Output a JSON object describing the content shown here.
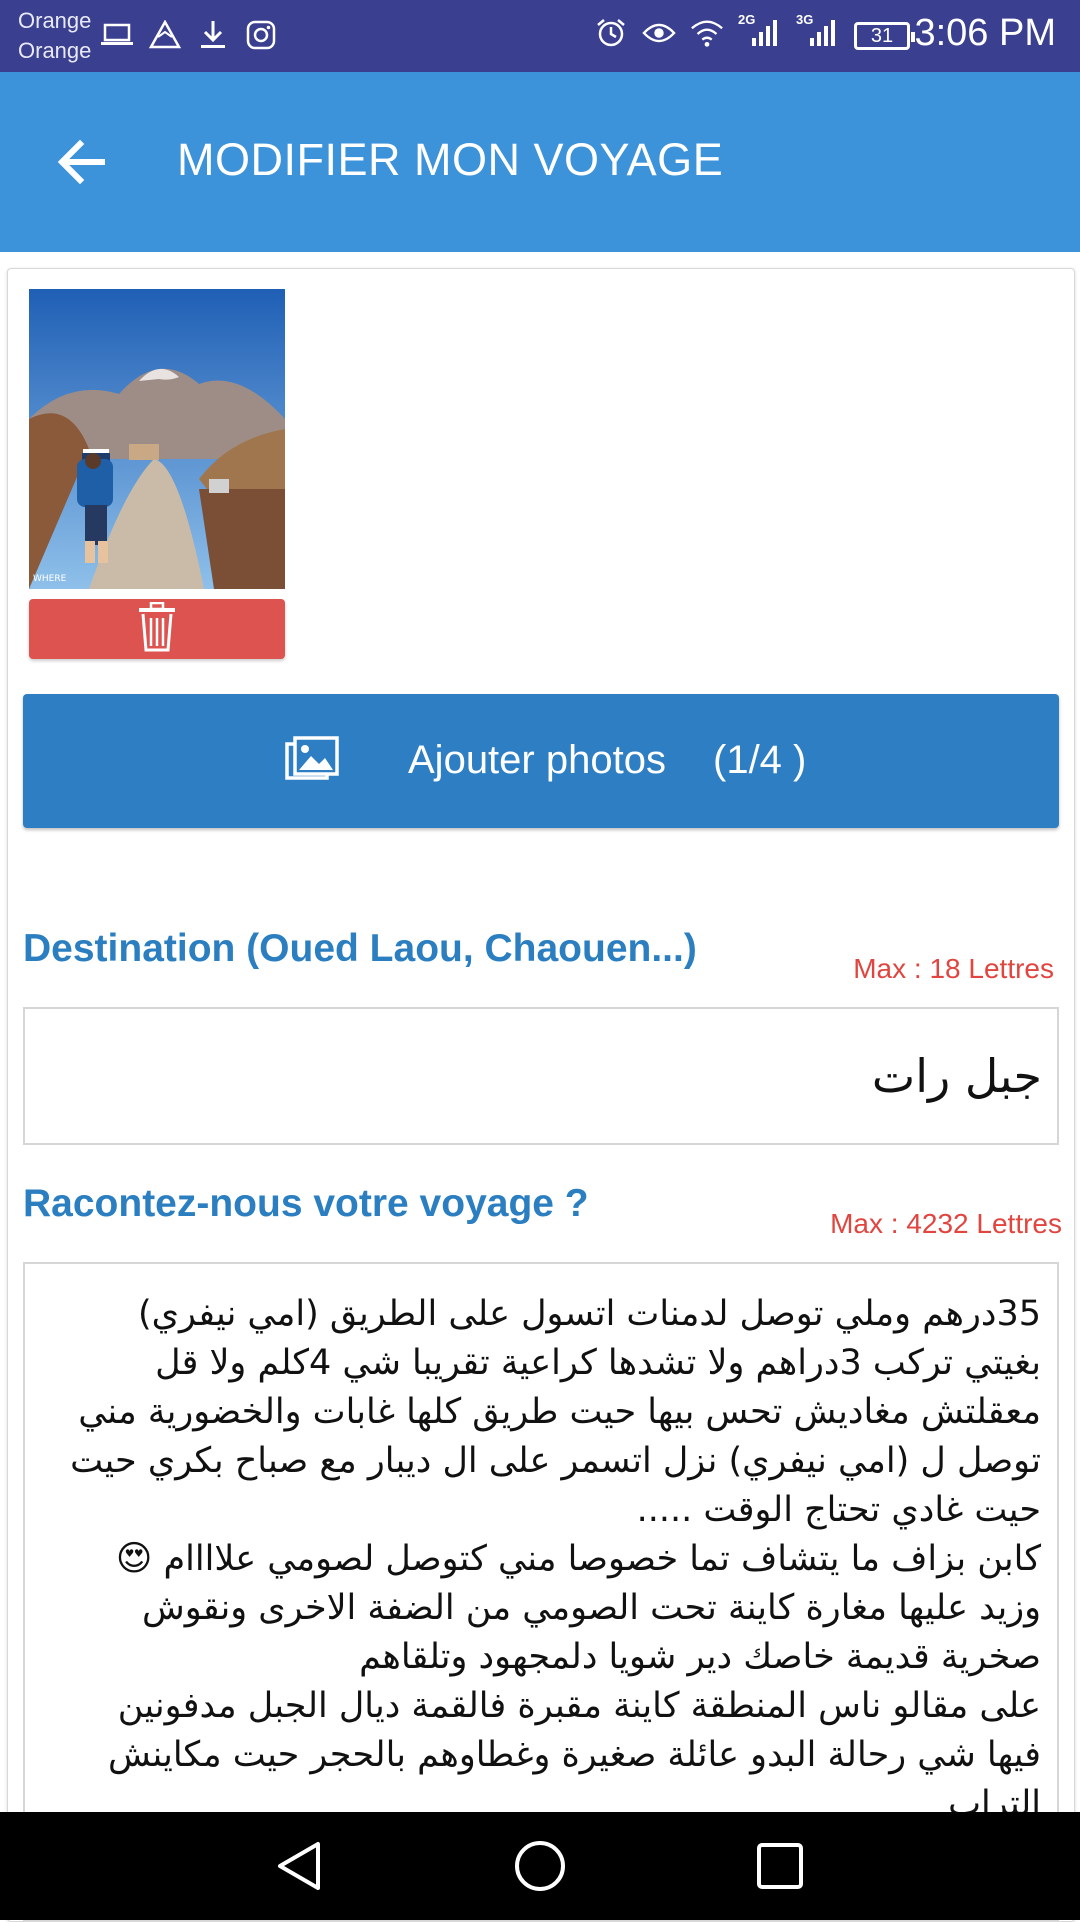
{
  "status_bar": {
    "carrier_line1": "Orange",
    "carrier_line2": "Orange",
    "left_icons": [
      "laptop-icon",
      "mountain-icon",
      "download-icon",
      "instagram-icon"
    ],
    "right_icons": [
      "alarm-icon",
      "eye-icon",
      "wifi-icon",
      "signal-2g-icon",
      "signal-3g-icon"
    ],
    "network_2g": "2G",
    "network_3g": "3G",
    "battery_level": "31",
    "time": "3:06 PM",
    "background_color": "#3a3f8f"
  },
  "app_bar": {
    "title": "MODIFIER MON VOYAGE",
    "back_icon": "arrow-left-icon",
    "background_color": "#3d93d9"
  },
  "photos": {
    "thumbnail_icon": "photo-thumbnail",
    "watermark": "WHERE",
    "delete_icon": "trash-icon",
    "add_label": "Ajouter photos",
    "add_count": "(1/4 )",
    "add_icon": "images-icon"
  },
  "destination": {
    "title": "Destination (Oued Laou, Chaouen...)",
    "max_label": "Max : 18 Lettres",
    "value": "جبل رات"
  },
  "story": {
    "title": "Racontez-nous votre voyage ?",
    "max_label": "Max : 4232 Lettres",
    "value": "35درهم وملي توصل لدمنات اتسول على الطريق (امي نيفري) بغيتي تركب 3دراهم ولا تشدها كراعية تقريبا شي 4كلم ولا قل معقلتش مغاديش تحس بيها حيت طريق كلها غابات والخضورية مني توصل ل (امي نيفري) نزل اتسمر على ال ديبار مع صباح بكري حيت حيت غادي تحتاج الوقت .....\nكابن بزاف ما يتشاف تما خصوصا مني كتوصل لصومي علاااام 😍\nوزيد عليها مغارة كاينة تحت الصومي من الضفة الاخرى ونقوش صخرية قديمة خاصك دير شويا دلمجهود وتلقاهم\nعلى مقالو ناس المنطقة كاينة مقبرة فالقمة ديال الجبل مدفونين فيها شي رحالة البدو عائلة صغيرة وغطاوهم بالحجر حيت مكاينش التراب"
  },
  "nav_bar": {
    "back_icon": "nav-back-icon",
    "home_icon": "nav-home-icon",
    "recents_icon": "nav-recents-icon"
  }
}
